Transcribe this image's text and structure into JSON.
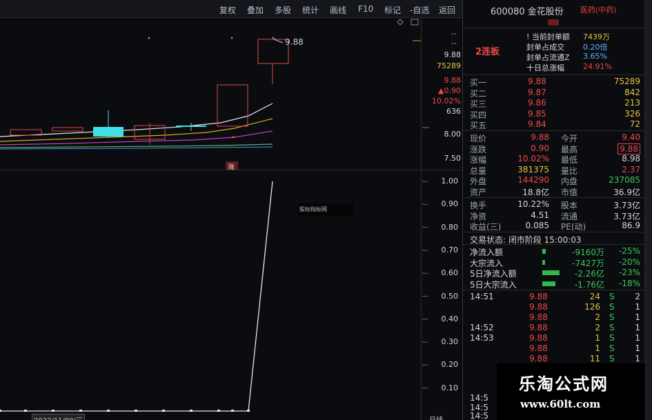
{
  "toolbar": {
    "items": [
      "复权",
      "叠加",
      "多股",
      "统计",
      "画线",
      "F10",
      "标记",
      "-自选",
      "返回"
    ]
  },
  "price_axis": {
    "dash1": "--",
    "dash2": "--",
    "prev_close": "9.88",
    "volume": "75289",
    "price": "9.88",
    "change": "▲0.90",
    "pct": "10.02%",
    "v636": "636",
    "t800": "8.00",
    "t750": "7.50"
  },
  "indicator_axis": [
    "1.00",
    "0.90",
    "0.80",
    "0.70",
    "0.60",
    "0.50",
    "0.40",
    "0.30",
    "0.20",
    "0.10"
  ],
  "chart": {
    "max_label": "9.88",
    "zt_mark": "涨",
    "indicator_label": "股标指标网",
    "date_label": "2022/11/09/三",
    "period_label": "日线",
    "indicator_values": [
      0,
      0,
      0,
      0,
      0,
      0,
      0,
      0,
      0,
      0,
      0,
      1.0
    ]
  },
  "panel": {
    "code_name": "600080 金花股份",
    "sector": "医药(中药)",
    "board": "2连板",
    "seal": [
      {
        "label": "当前封单额",
        "value": "7439万"
      },
      {
        "label": "封单占成交",
        "value": "0.20倍"
      },
      {
        "label": "封单占流通Z",
        "value": "3.65%"
      },
      {
        "label": "十日总涨幅",
        "value": "24.91%"
      }
    ],
    "bids": [
      {
        "label": "买一",
        "price": "9.88",
        "vol": "75289"
      },
      {
        "label": "买二",
        "price": "9.87",
        "vol": "842"
      },
      {
        "label": "买三",
        "price": "9.86",
        "vol": "213"
      },
      {
        "label": "买四",
        "price": "9.85",
        "vol": "326"
      },
      {
        "label": "买五",
        "price": "9.84",
        "vol": "72"
      }
    ],
    "stats": [
      {
        "l1": "现价",
        "v1": "9.88",
        "l2": "今开",
        "v2": "9.40"
      },
      {
        "l1": "涨跌",
        "v1": "0.90",
        "l2": "最高",
        "v2": "9.88"
      },
      {
        "l1": "涨幅",
        "v1": "10.02%",
        "l2": "最低",
        "v2": "8.98"
      },
      {
        "l1": "总量",
        "v1": "381375",
        "l2": "量比",
        "v2": "2.37"
      },
      {
        "l1": "外盘",
        "v1": "144290",
        "l2": "内盘",
        "v2": "237085"
      },
      {
        "l1": "资产",
        "v1": "18.8亿",
        "l2": "市值",
        "v2": "36.9亿"
      }
    ],
    "stats2": [
      {
        "l1": "换手",
        "v1": "10.22%",
        "l2": "股本",
        "v2": "3.73亿"
      },
      {
        "l1": "净资",
        "v1": "4.51",
        "l2": "流通",
        "v2": "3.73亿"
      },
      {
        "l1": "收益(三)",
        "v1": "0.085",
        "l2": "PE(动)",
        "v2": "86.9"
      }
    ],
    "status": "交易状态: 闭市阶段 15:00:03",
    "flows": [
      {
        "label": "净流入额",
        "value": "-9160万",
        "pct": "-25%",
        "bar": 0.12
      },
      {
        "label": "大宗流入",
        "value": "-7427万",
        "pct": "-20%",
        "bar": 0.1
      },
      {
        "label": "5日净流入额",
        "value": "-2.26亿",
        "pct": "-23%",
        "bar": 0.6
      },
      {
        "label": "5日大宗流入",
        "value": "-1.76亿",
        "pct": "-18%",
        "bar": 0.45
      }
    ],
    "ticks": [
      {
        "time": "14:51",
        "price": "9.88",
        "vol": "24",
        "side": "S",
        "n": "2"
      },
      {
        "time": "",
        "price": "9.88",
        "vol": "126",
        "side": "S",
        "n": "1"
      },
      {
        "time": "",
        "price": "9.88",
        "vol": "2",
        "side": "S",
        "n": "1"
      },
      {
        "time": "14:52",
        "price": "9.88",
        "vol": "2",
        "side": "S",
        "n": "1"
      },
      {
        "time": "14:53",
        "price": "9.88",
        "vol": "1",
        "side": "S",
        "n": "1"
      },
      {
        "time": "",
        "price": "9.88",
        "vol": "1",
        "side": "S",
        "n": "1"
      },
      {
        "time": "",
        "price": "9.88",
        "vol": "11",
        "side": "S",
        "n": "1"
      }
    ],
    "bottom_times": [
      "14:5",
      "14:5",
      "14:5"
    ]
  },
  "watermark": {
    "title": "乐淘公式网",
    "url": "www.60lt.com"
  }
}
